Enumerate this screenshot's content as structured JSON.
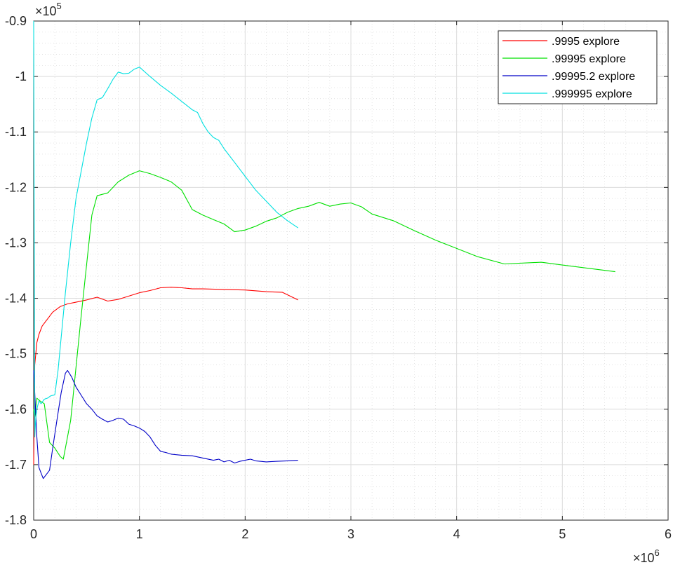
{
  "chart_data": {
    "type": "line",
    "title": "",
    "xlabel": "",
    "ylabel": "",
    "xlim": [
      0,
      6000000
    ],
    "ylim": [
      -180000,
      -90000
    ],
    "x_ticks": [
      0,
      1000000,
      2000000,
      3000000,
      4000000,
      5000000,
      6000000
    ],
    "x_tick_labels": [
      "0",
      "1",
      "2",
      "3",
      "4",
      "5",
      "6"
    ],
    "y_ticks": [
      -180000,
      -170000,
      -160000,
      -150000,
      -140000,
      -130000,
      -120000,
      -110000,
      -100000,
      -90000
    ],
    "y_tick_labels": [
      "-1.8",
      "-1.7",
      "-1.6",
      "-1.5",
      "-1.4",
      "-1.3",
      "-1.2",
      "-1.1",
      "-1",
      "-0.9"
    ],
    "x_exponent_base": "×10",
    "x_exponent_power": "6",
    "y_exponent_base": "×10",
    "y_exponent_power": "5",
    "grid": true,
    "minor_grid": true,
    "legend_position": "top-right",
    "series": [
      {
        "name": ".9995 explore",
        "color": "#ff0000",
        "x": [
          0,
          10000,
          30000,
          50000,
          80000,
          120000,
          180000,
          250000,
          320000,
          400000,
          500000,
          600000,
          700000,
          800000,
          900000,
          1000000,
          1100000,
          1200000,
          1300000,
          1400000,
          1500000,
          1600000,
          1800000,
          2000000,
          2200000,
          2350000,
          2500000
        ],
        "y": [
          -170000,
          -152000,
          -148000,
          -146500,
          -145000,
          -144000,
          -142500,
          -141500,
          -141000,
          -140700,
          -140300,
          -139800,
          -140500,
          -140200,
          -139600,
          -139000,
          -138600,
          -138100,
          -138000,
          -138100,
          -138300,
          -138300,
          -138400,
          -138500,
          -138800,
          -138900,
          -140300
        ]
      },
      {
        "name": ".99995 explore",
        "color": "#00e000",
        "x": [
          0,
          10000,
          30000,
          60000,
          100000,
          150000,
          200000,
          250000,
          280000,
          350000,
          450000,
          550000,
          600000,
          700000,
          800000,
          900000,
          1000000,
          1100000,
          1200000,
          1300000,
          1400000,
          1500000,
          1600000,
          1700000,
          1800000,
          1900000,
          2000000,
          2100000,
          2200000,
          2300000,
          2400000,
          2500000,
          2600000,
          2700000,
          2800000,
          2900000,
          3000000,
          3100000,
          3200000,
          3400000,
          3600000,
          3800000,
          4000000,
          4200000,
          4450000,
          4800000,
          5000000,
          5250000,
          5500000
        ],
        "y": [
          -160000,
          -161500,
          -158000,
          -158500,
          -159000,
          -166000,
          -167000,
          -168500,
          -169000,
          -162000,
          -143000,
          -125000,
          -121500,
          -121000,
          -119000,
          -117800,
          -117000,
          -117500,
          -118200,
          -119000,
          -120500,
          -124000,
          -125000,
          -125800,
          -126600,
          -128000,
          -127700,
          -127000,
          -126100,
          -125500,
          -124500,
          -123800,
          -123400,
          -122700,
          -123400,
          -123000,
          -122800,
          -123500,
          -124800,
          -126000,
          -127800,
          -129500,
          -131000,
          -132500,
          -133800,
          -133500,
          -134000,
          -134600,
          -135200
        ]
      },
      {
        "name": ".99995.2 explore",
        "color": "#0000c8",
        "x": [
          0,
          10000,
          30000,
          50000,
          70000,
          90000,
          110000,
          130000,
          150000,
          180000,
          220000,
          260000,
          300000,
          320000,
          360000,
          400000,
          450000,
          500000,
          550000,
          600000,
          650000,
          700000,
          750000,
          800000,
          850000,
          900000,
          950000,
          1000000,
          1050000,
          1100000,
          1150000,
          1200000,
          1250000,
          1300000,
          1400000,
          1500000,
          1600000,
          1700000,
          1750000,
          1800000,
          1850000,
          1900000,
          1950000,
          2000000,
          2050000,
          2100000,
          2200000,
          2300000,
          2400000,
          2500000
        ],
        "y": [
          -153000,
          -157000,
          -165000,
          -170500,
          -171500,
          -172500,
          -172000,
          -171500,
          -171000,
          -167000,
          -162000,
          -157000,
          -153500,
          -153000,
          -154200,
          -156000,
          -157500,
          -159000,
          -160000,
          -161200,
          -161800,
          -162300,
          -162000,
          -161600,
          -161800,
          -162700,
          -163000,
          -163400,
          -164000,
          -165000,
          -166500,
          -167600,
          -167800,
          -168100,
          -168300,
          -168400,
          -168800,
          -169200,
          -169000,
          -169500,
          -169200,
          -169700,
          -169400,
          -169200,
          -169000,
          -169300,
          -169500,
          -169400,
          -169300,
          -169200
        ]
      },
      {
        "name": ".999995 explore",
        "color": "#00e0e0",
        "x": [
          0,
          10000,
          20000,
          30000,
          50000,
          70000,
          100000,
          130000,
          160000,
          200000,
          230000,
          250000,
          300000,
          350000,
          400000,
          450000,
          500000,
          550000,
          600000,
          650000,
          700000,
          750000,
          800000,
          850000,
          900000,
          950000,
          1000000,
          1100000,
          1200000,
          1300000,
          1400000,
          1500000,
          1550000,
          1600000,
          1650000,
          1700000,
          1750000,
          1800000,
          1900000,
          2000000,
          2100000,
          2200000,
          2300000,
          2400000,
          2500000
        ],
        "y": [
          -90000,
          -165000,
          -161500,
          -160000,
          -158500,
          -159000,
          -158200,
          -158000,
          -157600,
          -157400,
          -153000,
          -149000,
          -139000,
          -130000,
          -122000,
          -117000,
          -112000,
          -107500,
          -104200,
          -103800,
          -102200,
          -100500,
          -99200,
          -99500,
          -99400,
          -98700,
          -98300,
          -100000,
          -101600,
          -103000,
          -104500,
          -106000,
          -106500,
          -108500,
          -110000,
          -111000,
          -111500,
          -113000,
          -115500,
          -118000,
          -120500,
          -122500,
          -124500,
          -126000,
          -127300
        ]
      }
    ]
  }
}
